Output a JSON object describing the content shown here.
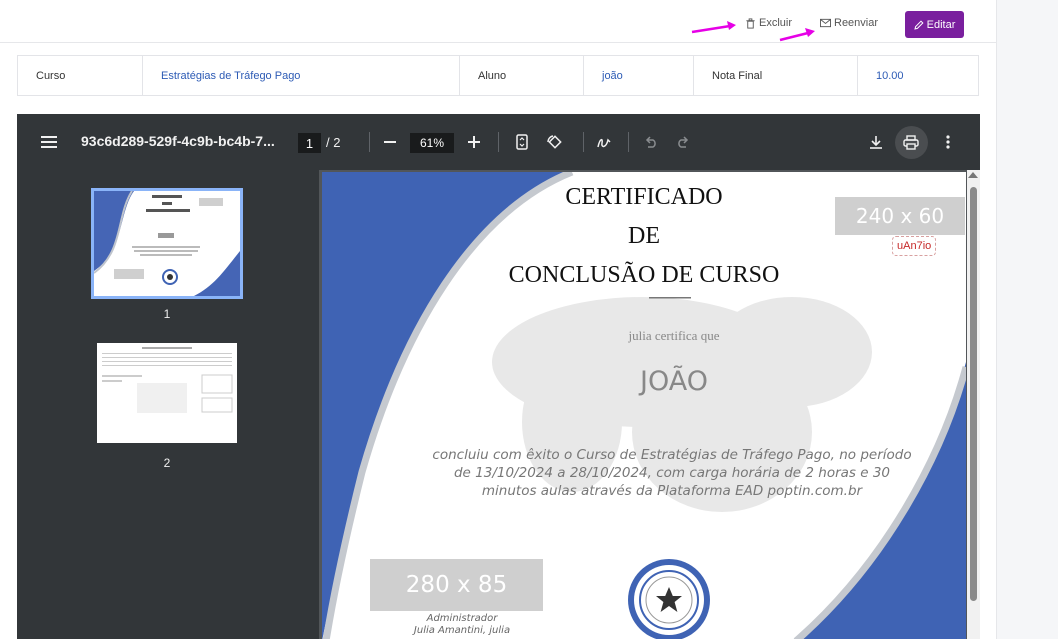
{
  "actions": {
    "excluir_label": "Excluir",
    "reenviar_label": "Reenviar",
    "editar_label": "Editar"
  },
  "info": {
    "curso_label": "Curso",
    "curso_value": "Estratégias de Tráfego Pago",
    "aluno_label": "Aluno",
    "aluno_value": "joão",
    "nota_label": "Nota Final",
    "nota_value": "10.00"
  },
  "viewer": {
    "doc_title": "93c6d289-529f-4c9b-bc4b-7...",
    "current_page": "1",
    "total_pages": "/ 2",
    "zoom": "61%",
    "thumbnails": [
      "1",
      "2"
    ]
  },
  "certificate": {
    "title_line1": "CERTIFICADO",
    "title_line2": "DE",
    "title_line3": "CONCLUSÃO DE CURSO",
    "certifies": "julia certifica que",
    "student_name": "JOÃO",
    "body": "concluiu com êxito o Curso de Estratégias de Tráfego Pago, no período de 13/10/2024 a 28/10/2024, com carga horária de 2 horas e 30 minutos aulas através da Plataforma EAD poptin.com.br",
    "logo_placeholder": "240 x 60",
    "logo_badge": "uAn7io",
    "signature_placeholder": "280 x 85",
    "signature_role": "Administrador",
    "signature_name": "Julia Amantini, julia"
  },
  "colors": {
    "accent_purple": "#7a1f9e",
    "link_blue": "#2d5bb5",
    "toolbar_bg": "#323639",
    "cert_blue": "#3f63b4",
    "arrow_magenta": "#e600e6"
  }
}
